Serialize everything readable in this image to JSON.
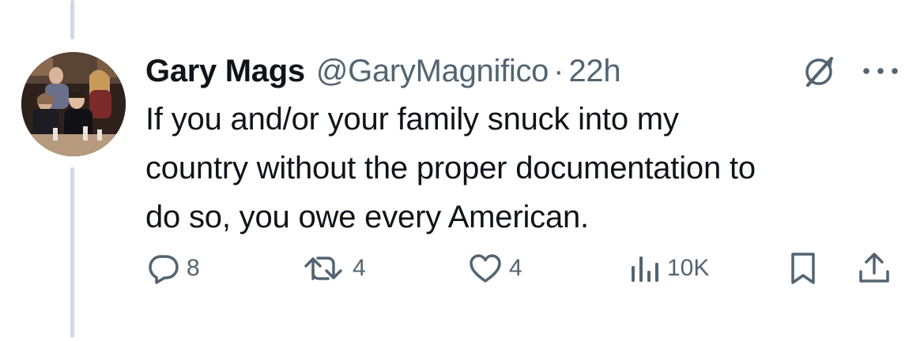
{
  "tweet": {
    "display_name": "Gary Mags",
    "handle": "@GaryMagnifico",
    "separator": "·",
    "time": "22h",
    "text_lines": [
      "If you and/or your family snuck into my",
      "country without the proper documentation to",
      "do so, you owe every American."
    ]
  },
  "actions": {
    "replies": "8",
    "reposts": "4",
    "likes": "4",
    "views": "10K"
  },
  "icons": {
    "reply": "reply-icon",
    "repost": "repost-icon",
    "like": "heart-icon",
    "views": "views-chart-icon",
    "bookmark": "bookmark-icon",
    "share": "share-icon",
    "grok": "grok-icon",
    "more": "more-dots-icon"
  },
  "colors": {
    "text_primary": "#0f1419",
    "text_secondary": "#536471",
    "thread_line": "#cfd9de"
  }
}
